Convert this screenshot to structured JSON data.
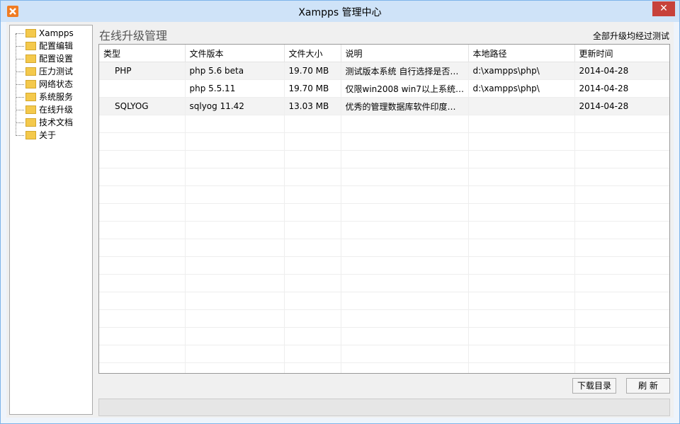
{
  "window": {
    "title": "Xampps 管理中心",
    "close_label": "✕"
  },
  "sidebar": {
    "items": [
      {
        "label": "Xampps"
      },
      {
        "label": "配置编辑"
      },
      {
        "label": "配置设置"
      },
      {
        "label": "压力测试"
      },
      {
        "label": "网络状态"
      },
      {
        "label": "系统服务"
      },
      {
        "label": "在线升级"
      },
      {
        "label": "技术文档"
      },
      {
        "label": "关于"
      }
    ]
  },
  "panel": {
    "title": "在线升级管理",
    "status": "全部升级均经过测试"
  },
  "table": {
    "columns": [
      "类型",
      "文件版本",
      "文件大小",
      "说明",
      "本地路径",
      "更新时间"
    ],
    "rows": [
      [
        "PHP",
        "php 5.6 beta",
        "19.70 MB",
        "测试版本系统 自行选择是否…",
        "d:\\xampps\\php\\",
        "2014-04-28"
      ],
      [
        "",
        "php 5.5.11",
        "19.70 MB",
        "仅限win2008 win7以上系统…",
        "d:\\xampps\\php\\",
        "2014-04-28"
      ],
      [
        "SQLYOG",
        "sqlyog 11.42",
        "13.03 MB",
        "优秀的管理数据库软件印度…",
        "",
        "2014-04-28"
      ]
    ]
  },
  "buttons": {
    "download_dir": "下载目录",
    "refresh": "刷 新"
  },
  "colors": {
    "titlebar": "#cfe3f8",
    "close": "#c7413a",
    "folder": "#f4c94c",
    "app_icon": "#f07c22"
  }
}
